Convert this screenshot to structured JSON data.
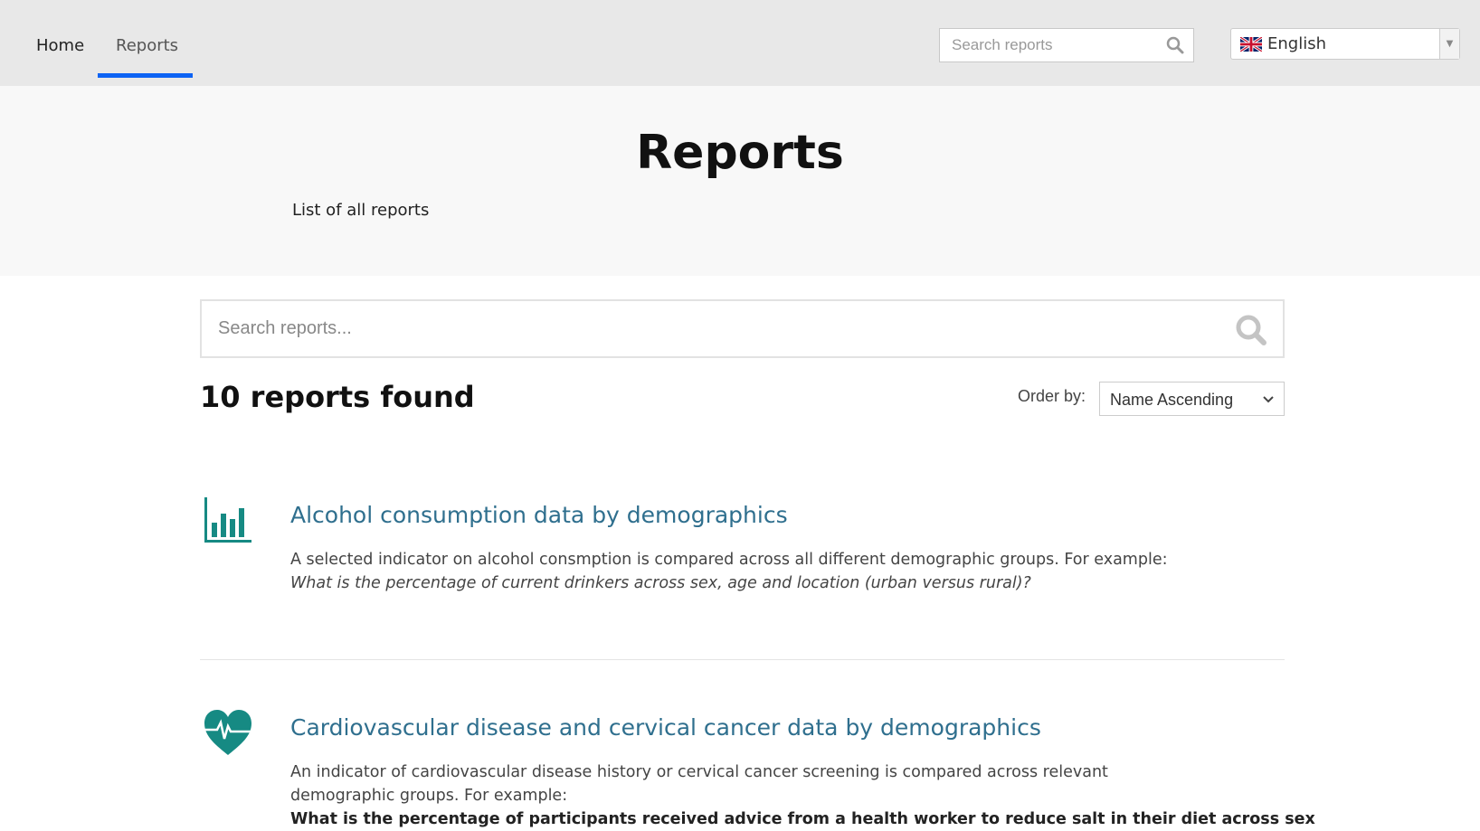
{
  "nav": {
    "items": [
      {
        "label": "Home"
      },
      {
        "label": "Reports",
        "active": true
      }
    ],
    "search_placeholder": "Search reports",
    "language": "English",
    "accent_color": "#0d63f4"
  },
  "hero": {
    "title": "Reports",
    "subtitle": "List of all reports"
  },
  "search": {
    "placeholder": "Search reports..."
  },
  "results": {
    "count_text": "10 reports found",
    "order_label": "Order by:",
    "order_value": "Name Ascending"
  },
  "reports": [
    {
      "icon": "bar-chart-icon",
      "title": "Alcohol consumption data by demographics",
      "description": "A selected indicator on alcohol consmption is compared across all different demographic groups. For example:",
      "example": "What is the percentage of current drinkers across sex, age and location (urban versus rural)?"
    },
    {
      "icon": "heart-pulse-icon",
      "title": "Cardiovascular disease and cervical cancer data by demographics",
      "description": "An indicator of cardiovascular disease history or cervical cancer screening is compared across relevant demographic groups. For example:",
      "example": "What is the percentage of participants received advice from a health worker to reduce salt in their diet across sex"
    }
  ],
  "colors": {
    "icon": "#168a83",
    "title": "#2f6f8e"
  }
}
